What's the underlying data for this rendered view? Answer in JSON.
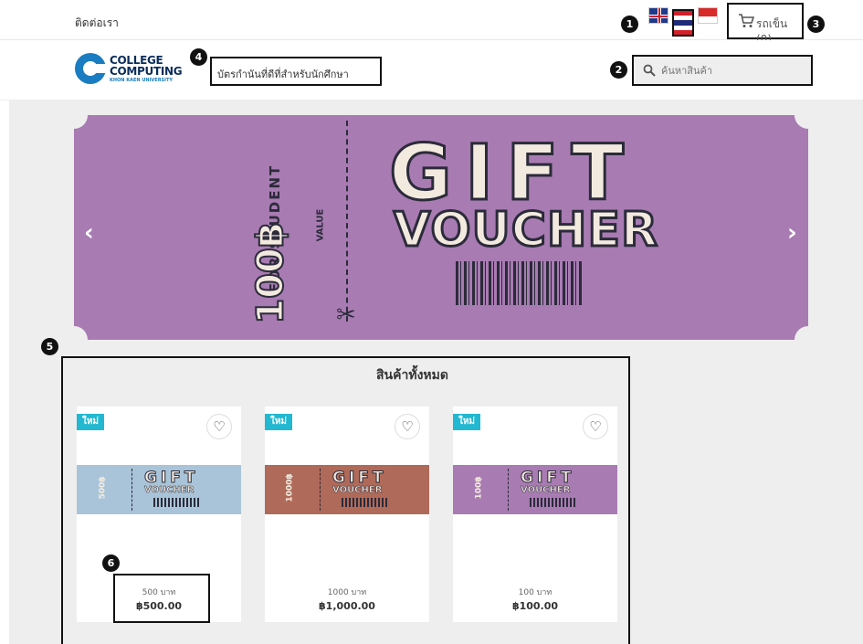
{
  "topbar": {
    "contact": "ติดต่อเรา",
    "cart_label": "รถเข็น (0)"
  },
  "header": {
    "logo_line1": "COLLEGE",
    "logo_line2": "COMPUTING",
    "logo_line3": "KHON KAEN UNIVERSITY",
    "tagline": "บัตรกำนันที่ดีที่สำหรับนักศึกษา",
    "search_placeholder": "ค้นหาสินค้า"
  },
  "banner": {
    "for_student": "FOR STUDENT",
    "amount": "100฿",
    "value_label": "VALUE",
    "gift": "GIFT",
    "voucher": "VOUCHER"
  },
  "annotations": [
    "1",
    "2",
    "3",
    "4",
    "5",
    "6"
  ],
  "products": {
    "section_title": "สินค้าทั้งหมด",
    "items": [
      {
        "badge": "ใหม่",
        "stub": "500฿",
        "gift": "GIFT",
        "voucher": "VOUCHER",
        "name": "500 บาท",
        "price": "฿500.00",
        "color": "#a9c4d8"
      },
      {
        "badge": "ใหม่",
        "stub": "1000฿",
        "gift": "GIFT",
        "voucher": "VOUCHER",
        "name": "1000 บาท",
        "price": "฿1,000.00",
        "color": "#b06a5a"
      },
      {
        "badge": "ใหม่",
        "stub": "100฿",
        "gift": "GIFT",
        "voucher": "VOUCHER",
        "name": "100 บาท",
        "price": "฿100.00",
        "color": "#a87bb2"
      }
    ]
  },
  "colors": {
    "banner_bg": "#a87bb2",
    "new_badge": "#22b8d1",
    "logo_blue": "#1a7cc1"
  }
}
